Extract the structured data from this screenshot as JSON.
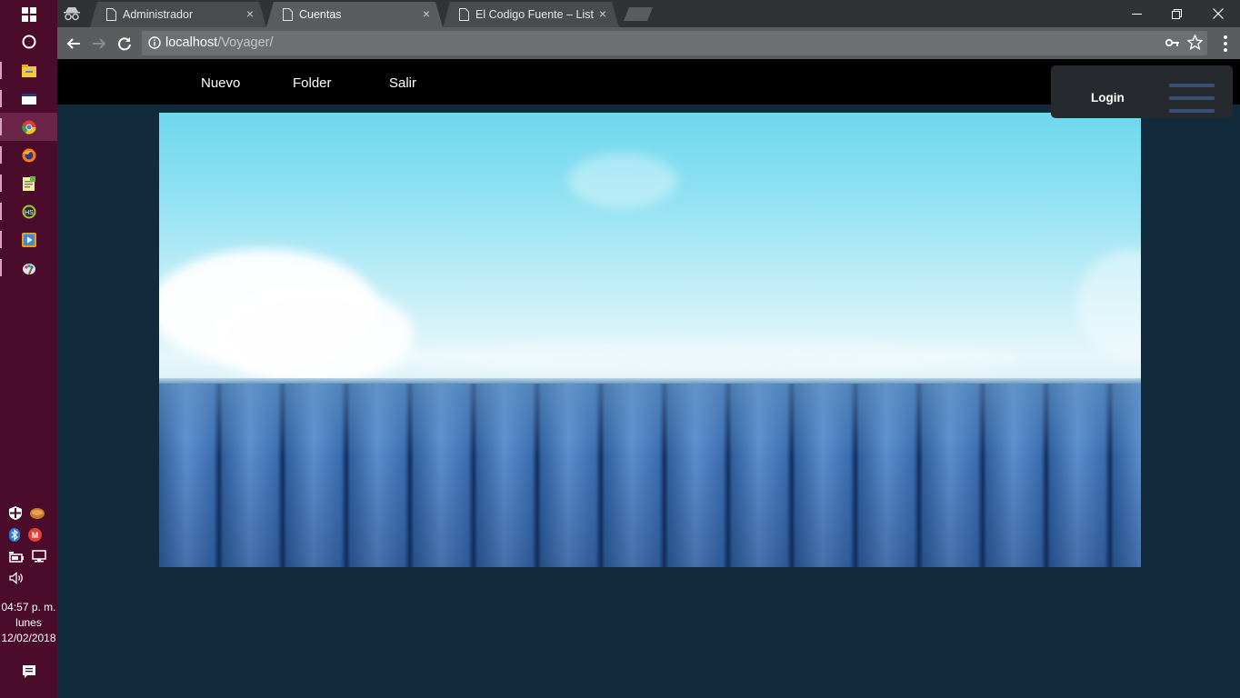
{
  "taskbar": {
    "clock": {
      "time": "04:57 p. m.",
      "day": "lunes",
      "date": "12/02/2018"
    },
    "apps": [
      "windows-start-icon",
      "cortana-icon",
      "file-explorer-icon",
      "window-icon",
      "chrome-icon",
      "firefox-icon",
      "notepad-icon",
      "hs-app-icon",
      "media-player-icon",
      "paint-icon"
    ]
  },
  "browser": {
    "tabs": [
      {
        "label": "Administrador",
        "close": "×"
      },
      {
        "label": "Cuentas",
        "close": "×"
      },
      {
        "label": "El Codigo Fuente – Listar",
        "close": "×"
      }
    ],
    "url_host": "localhost",
    "url_path": "/Voyager/"
  },
  "site": {
    "nav": {
      "nuevo": "Nuevo",
      "folder": "Folder",
      "salir": "Salir"
    },
    "login": "Login"
  },
  "colors": {
    "taskbar": "#4a0c2a",
    "page_bg": "#112b3c",
    "navbar": "#000000",
    "login_panel": "#262a2e",
    "hamburger": "#3b4f72"
  }
}
